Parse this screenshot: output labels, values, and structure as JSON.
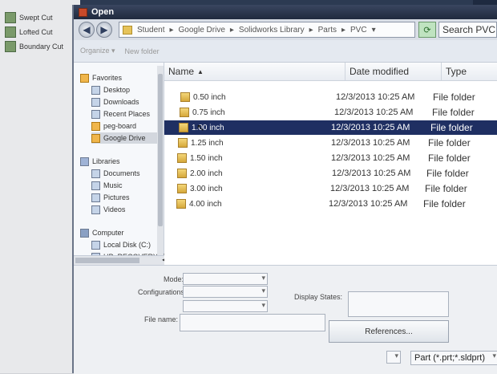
{
  "background_app": {
    "ribbon_items": [
      "Swept Cut",
      "Lofted Cut",
      "Boundary Cut"
    ]
  },
  "dialog": {
    "title": "Open",
    "breadcrumb": [
      "Student",
      "Google Drive",
      "Solidworks Library",
      "Parts",
      "PVC"
    ],
    "search_placeholder": "Search PVC",
    "toolbar": {
      "organize": "Organize ▾",
      "new_folder": "New folder"
    }
  },
  "nav": {
    "favorites_header": "Favorites",
    "favorites": [
      "Desktop",
      "Downloads",
      "Recent Places",
      "peg-board",
      "Google Drive"
    ],
    "libraries_header": "Libraries",
    "libraries": [
      "Documents",
      "Music",
      "Pictures",
      "Videos"
    ],
    "computer_header": "Computer",
    "computer": [
      "Local Disk (C:)",
      "HP_RECOVERY (E:"
    ],
    "selected": "Google Drive"
  },
  "columns": {
    "name": "Name",
    "date": "Date modified",
    "type": "Type"
  },
  "files": [
    {
      "name": "0.50 inch",
      "date": "12/3/2013 10:25 AM",
      "type": "File folder"
    },
    {
      "name": "0.75 inch",
      "date": "12/3/2013 10:25 AM",
      "type": "File folder"
    },
    {
      "name": "1.00 inch",
      "date": "12/3/2013 10:25 AM",
      "type": "File folder",
      "selected": true
    },
    {
      "name": "1.25 inch",
      "date": "12/3/2013 10:25 AM",
      "type": "File folder"
    },
    {
      "name": "1.50 inch",
      "date": "12/3/2013 10:25 AM",
      "type": "File folder"
    },
    {
      "name": "2.00 inch",
      "date": "12/3/2013 10:25 AM",
      "type": "File folder"
    },
    {
      "name": "3.00 inch",
      "date": "12/3/2013 10:25 AM",
      "type": "File folder"
    },
    {
      "name": "4.00 inch",
      "date": "12/3/2013 10:25 AM",
      "type": "File folder"
    }
  ],
  "form": {
    "mode_label": "Mode:",
    "configurations_label": "Configurations:",
    "display_states_label": "Display States:",
    "file_name_label": "File name:",
    "references_button": "References...",
    "file_type_value": "Part (*.prt;*.sldprt)"
  },
  "colors": {
    "selection": "#1f2f62",
    "titlebar": "#202a3e"
  }
}
